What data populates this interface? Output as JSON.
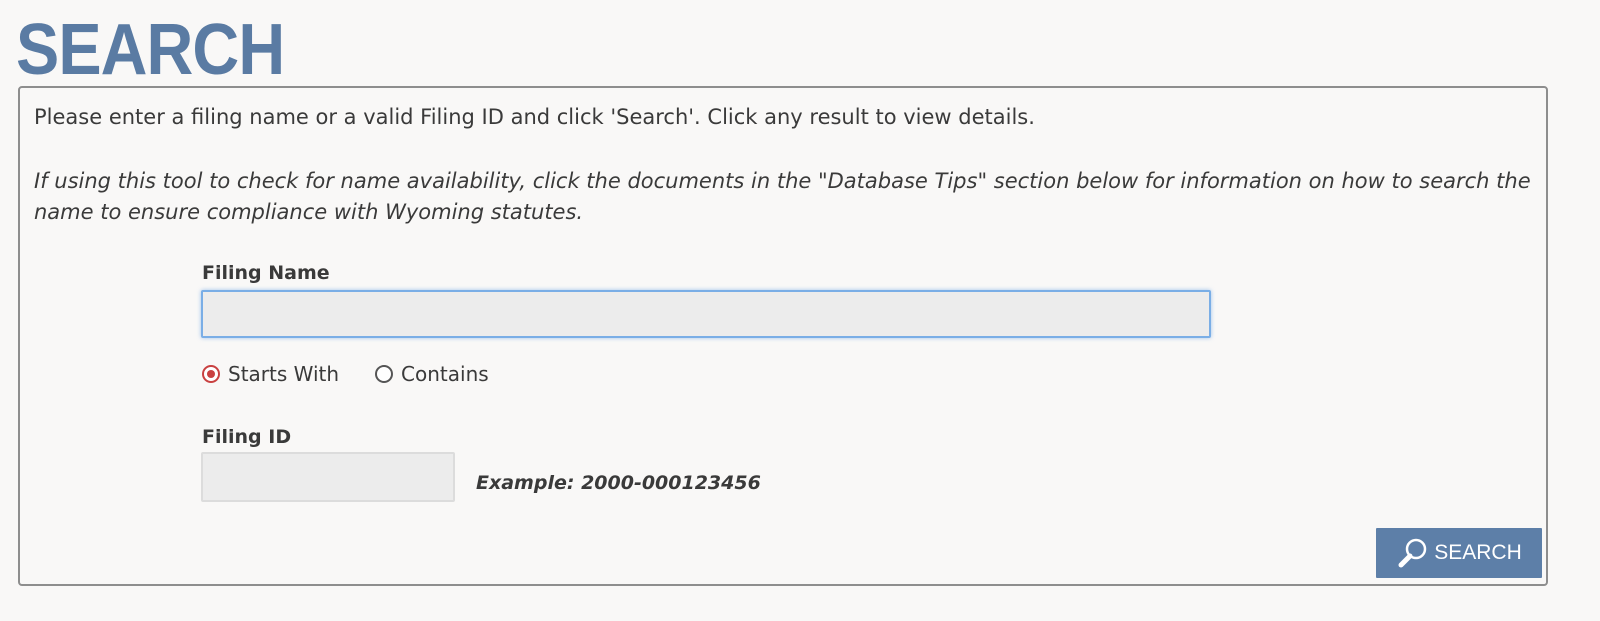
{
  "page": {
    "title": "SEARCH"
  },
  "panel": {
    "intro": "Please enter a filing name or a valid Filing ID and click 'Search'. Click any result to view details.",
    "tip": "If using this tool to check for name availability, click the documents in the \"Database Tips\" section below for information on how to search the name to ensure compliance with Wyoming statutes."
  },
  "filing_name": {
    "label": "Filing Name",
    "value": "",
    "placeholder": ""
  },
  "match_mode": {
    "options": [
      {
        "label": "Starts With",
        "selected": true
      },
      {
        "label": "Contains",
        "selected": false
      }
    ]
  },
  "filing_id": {
    "label": "Filing ID",
    "value": "",
    "placeholder": "",
    "example": "Example: 2000-000123456"
  },
  "search_button": {
    "label": "SEARCH",
    "icon": "magnifier-icon"
  },
  "colors": {
    "title": "#5a7ba3",
    "button": "#5d7fa8",
    "radio_selected": "#c94141",
    "input_focus_border": "#7aaee6"
  }
}
